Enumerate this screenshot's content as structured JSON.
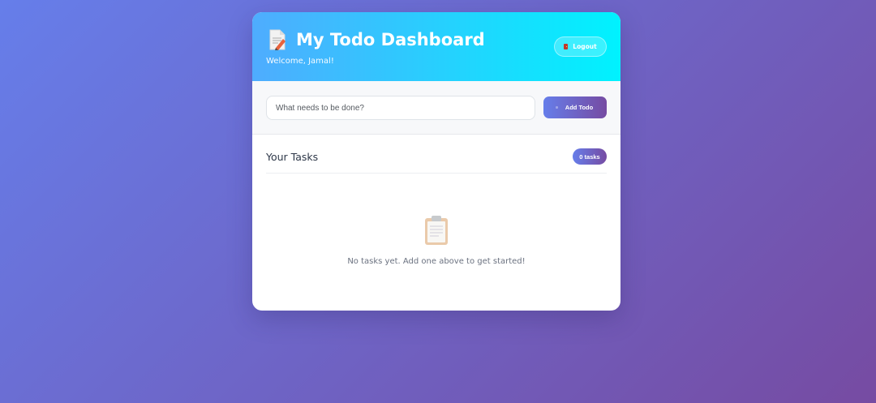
{
  "header": {
    "title": "My Todo Dashboard",
    "welcome": "Welcome, Jamal!",
    "logout_label": "Logout",
    "gradient_start": "#4facfe",
    "gradient_end": "#00f2fe"
  },
  "input_section": {
    "placeholder": "What needs to be done?",
    "value": "",
    "add_label": "Add Todo"
  },
  "tasks": {
    "title": "Your Tasks",
    "count_label": "0 tasks",
    "items": []
  },
  "empty_state": {
    "text": "No tasks yet. Add one above to get started!",
    "icon": "clipboard-icon"
  },
  "icons": {
    "title_icon": "memo-icon",
    "logout_icon": "door-icon",
    "add_icon": "plus-icon"
  },
  "colors": {
    "background_start": "#667eea",
    "background_end": "#764ba2",
    "accent": "#667eea"
  }
}
